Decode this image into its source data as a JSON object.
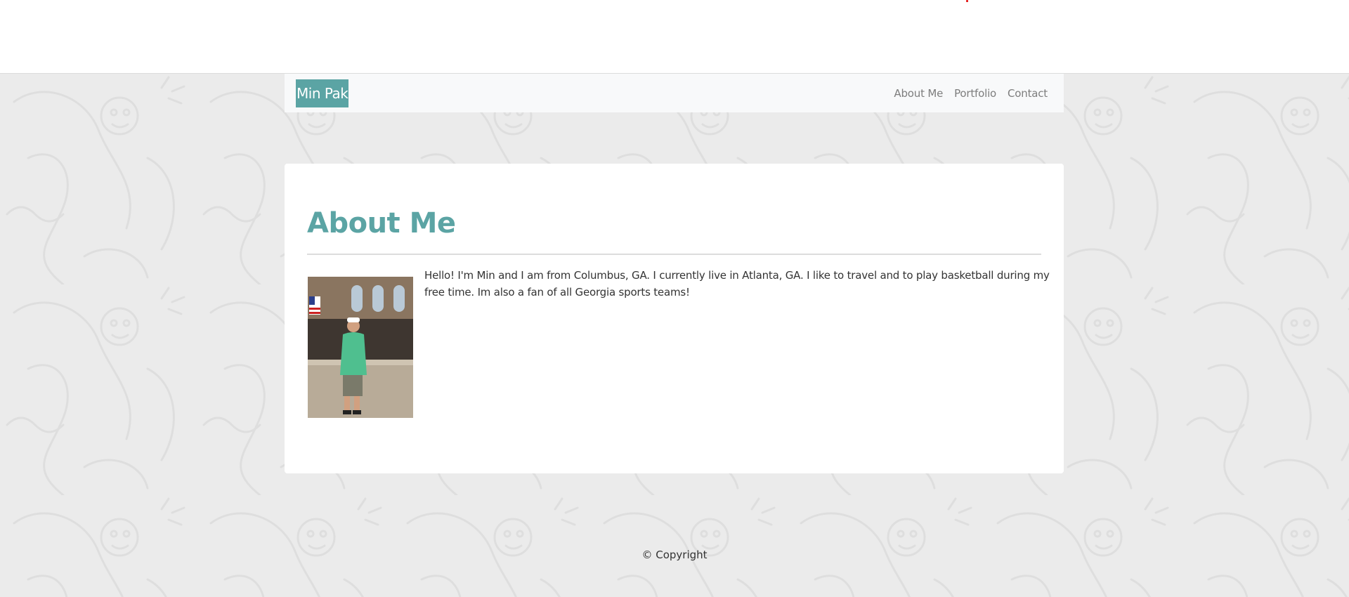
{
  "colors": {
    "accent": "#5ba4a4",
    "background_pattern": "#ebebeb",
    "navbar_bg": "#f8f9fa",
    "nav_text": "#7d7d7d",
    "body_text": "#333333",
    "marker_red": "#e00000"
  },
  "navbar": {
    "brand": "Min Pak",
    "links": [
      "About Me",
      "Portfolio",
      "Contact"
    ]
  },
  "about": {
    "title": "About Me",
    "paragraph": "Hello! I'm Min and I am from Columbus, GA. I currently live in Atlanta, GA. I like to travel and to play basketball during my free time. Im also a fan of all Georgia sports teams!",
    "photo": {
      "kind": "photograph",
      "description_icon": "profile-photo"
    }
  },
  "footer": {
    "text": "© Copyright"
  }
}
